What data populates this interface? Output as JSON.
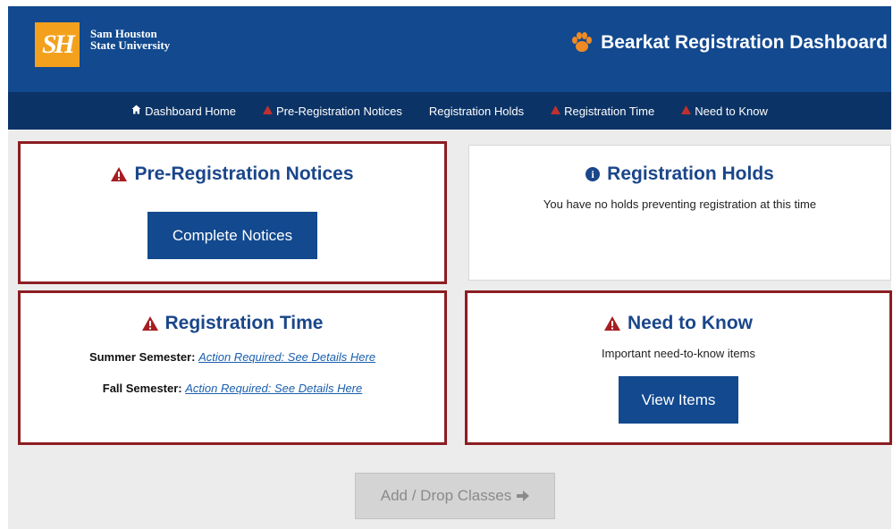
{
  "header": {
    "logo_initials": "SH",
    "university_line1": "Sam Houston",
    "university_line2": "State University",
    "title": "Bearkat Registration Dashboard"
  },
  "nav": {
    "items": [
      {
        "label": "Dashboard Home",
        "icon": "home-icon"
      },
      {
        "label": "Pre-Registration Notices",
        "icon": "warning-icon"
      },
      {
        "label": "Registration Holds",
        "icon": ""
      },
      {
        "label": "Registration Time",
        "icon": "warning-icon"
      },
      {
        "label": "Need to Know",
        "icon": "warning-icon"
      }
    ]
  },
  "cards": {
    "pre_registration": {
      "title": "Pre-Registration Notices",
      "button": "Complete Notices"
    },
    "holds": {
      "title": "Registration Holds",
      "message": "You have no holds preventing registration at this time"
    },
    "time": {
      "title": "Registration Time",
      "rows": [
        {
          "semester": "Summer Semester:",
          "link": "Action Required: See Details Here"
        },
        {
          "semester": "Fall Semester:",
          "link": "Action Required: See Details Here"
        }
      ]
    },
    "need_to_know": {
      "title": "Need to Know",
      "message": "Important need-to-know items",
      "button": "View Items"
    }
  },
  "footer": {
    "add_drop_label": "Add / Drop Classes",
    "add_drop_icon": "arrow-right-icon"
  },
  "colors": {
    "brand_blue": "#12498f",
    "nav_blue": "#0b3366",
    "alert_red": "#8c1d22",
    "logo_orange": "#f3a11d"
  }
}
